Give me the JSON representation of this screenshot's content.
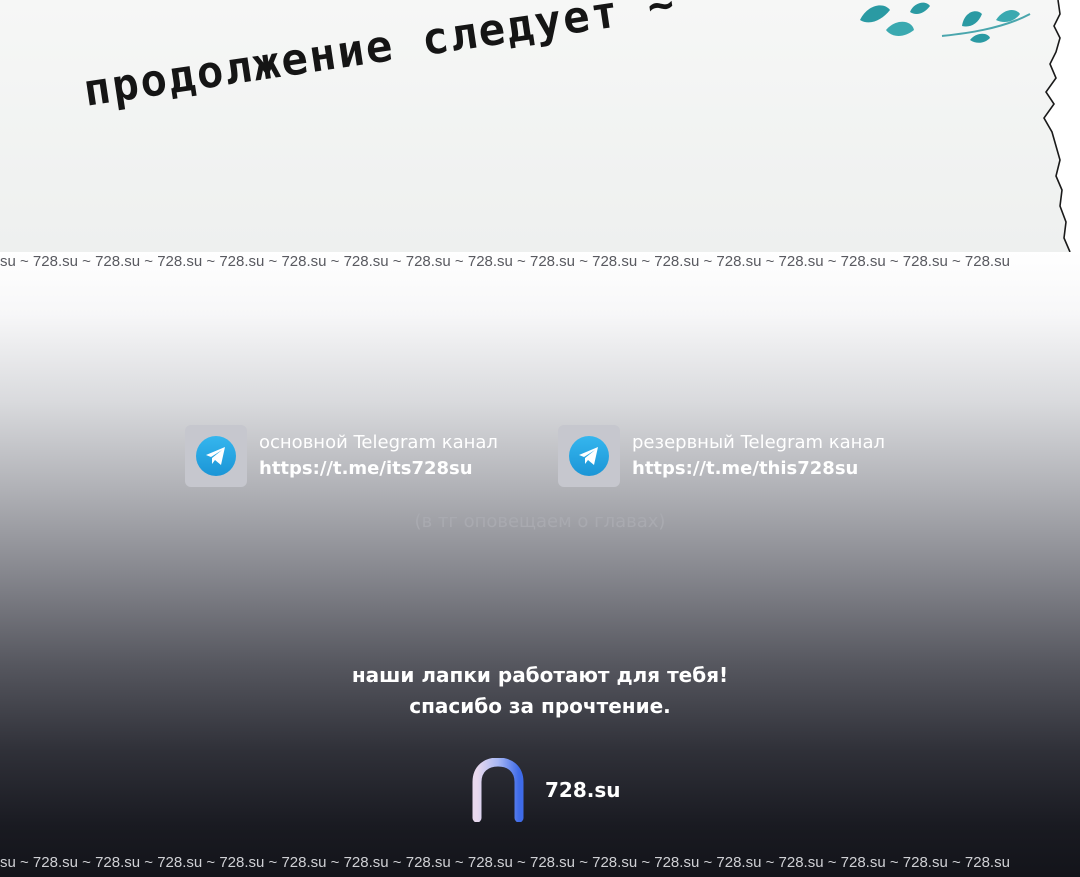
{
  "panel": {
    "continue_text": "продолжение следует ~"
  },
  "watermark": {
    "text": "su ~ 728.su ~ 728.su ~ 728.su ~ 728.su ~ 728.su ~ 728.su ~ 728.su ~ 728.su ~ 728.su ~ 728.su ~ 728.su ~ 728.su ~ 728.su ~ 728.su ~ 728.su ~ 728.su"
  },
  "telegram": [
    {
      "label": "основной Telegram канал",
      "link": "https://t.me/its728su"
    },
    {
      "label": "резервный Telegram канал",
      "link": "https://t.me/this728su"
    }
  ],
  "note": "(в тг оповещаем о главах)",
  "thanks": {
    "line1": "наши лапки работают для тебя!",
    "line2": "спасибо за прочтение."
  },
  "brand": {
    "name": "728.su"
  },
  "colors": {
    "telegram_blue": "#229ED9",
    "leaf_teal": "#2a9aa3"
  },
  "icons": {
    "telegram": "telegram-icon",
    "logo": "728su-logo-icon",
    "leaves": "leaves-decoration-icon"
  }
}
